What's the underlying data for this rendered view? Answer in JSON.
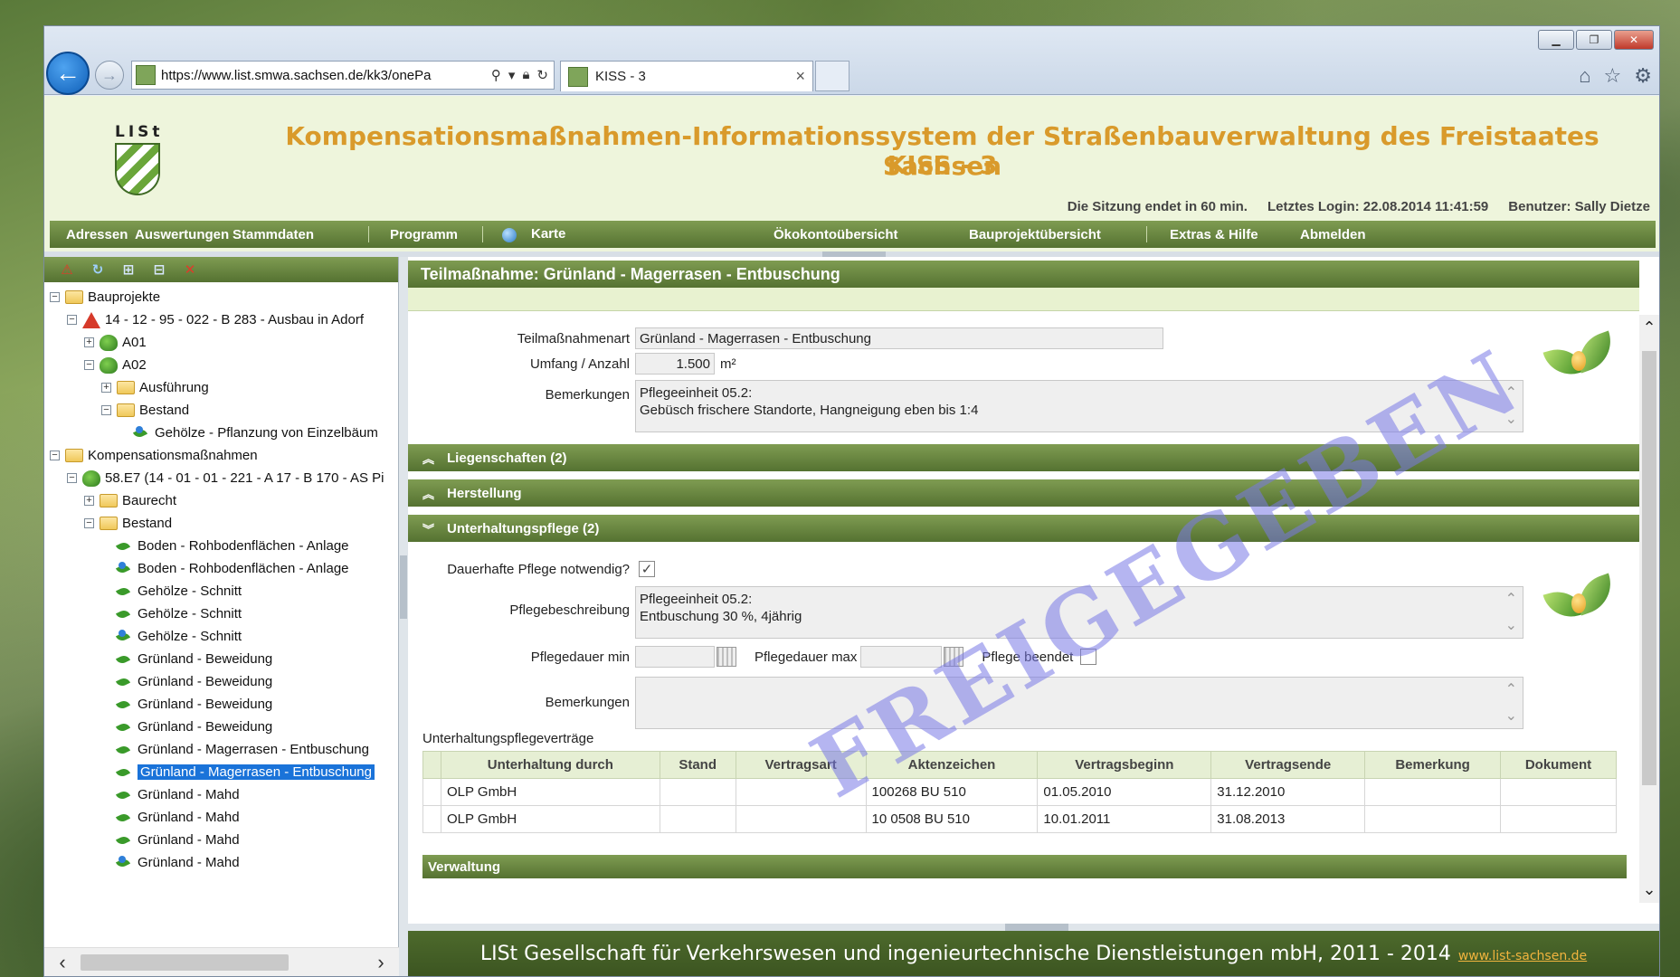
{
  "browser": {
    "url": "https://www.list.smwa.sachsen.de/kk3/onePa",
    "tab_title": "KISS - 3"
  },
  "header": {
    "logo_text": "LISt",
    "title_line1": "Kompensationsmaßnahmen-Informationssystem der Straßenbauverwaltung des Freistaates Sachsen",
    "title_line2": "KISS - 3",
    "session_end": "Die Sitzung endet in 60 min.",
    "last_login": "Letztes Login: 22.08.2014 11:41:59",
    "user": "Benutzer: Sally Dietze"
  },
  "menu": {
    "adressen": "Adressen",
    "auswertungen": "Auswertungen",
    "stammdaten": "Stammdaten",
    "programm": "Programm",
    "karte": "Karte",
    "oekokonto": "Ökokontoübersicht",
    "bauprojekt": "Bauprojektübersicht",
    "extras": "Extras & Hilfe",
    "abmelden": "Abmelden"
  },
  "tree": [
    {
      "label": "Bauprojekte",
      "level": 0,
      "toggle": "−",
      "icon": "folder"
    },
    {
      "label": "14 - 12 - 95 - 022 - B 283 - Ausbau in Adorf",
      "level": 1,
      "toggle": "−",
      "icon": "warn"
    },
    {
      "label": "A01",
      "level": 2,
      "toggle": "+",
      "icon": "tree"
    },
    {
      "label": "A02",
      "level": 2,
      "toggle": "−",
      "icon": "tree"
    },
    {
      "label": "Ausführung",
      "level": 3,
      "toggle": "+",
      "icon": "folder"
    },
    {
      "label": "Bestand",
      "level": 3,
      "toggle": "−",
      "icon": "folder"
    },
    {
      "label": "Gehölze - Pflanzung von Einzelbäum",
      "level": 4,
      "toggle": "",
      "icon": "leaf-blue"
    },
    {
      "label": "Kompensationsmaßnahmen",
      "level": 0,
      "toggle": "−",
      "icon": "folder"
    },
    {
      "label": "58.E7 (14 - 01 - 01 - 221 - A 17 - B 170 - AS Pi",
      "level": 1,
      "toggle": "−",
      "icon": "tree"
    },
    {
      "label": "Baurecht",
      "level": 2,
      "toggle": "+",
      "icon": "folder"
    },
    {
      "label": "Bestand",
      "level": 2,
      "toggle": "−",
      "icon": "folder"
    },
    {
      "label": "Boden - Rohbodenflächen - Anlage",
      "level": 3,
      "toggle": "",
      "icon": "leaf"
    },
    {
      "label": "Boden - Rohbodenflächen - Anlage",
      "level": 3,
      "toggle": "",
      "icon": "leaf-blue"
    },
    {
      "label": "Gehölze - Schnitt",
      "level": 3,
      "toggle": "",
      "icon": "leaf"
    },
    {
      "label": "Gehölze - Schnitt",
      "level": 3,
      "toggle": "",
      "icon": "leaf"
    },
    {
      "label": "Gehölze - Schnitt",
      "level": 3,
      "toggle": "",
      "icon": "leaf-blue"
    },
    {
      "label": "Grünland - Beweidung",
      "level": 3,
      "toggle": "",
      "icon": "leaf"
    },
    {
      "label": "Grünland - Beweidung",
      "level": 3,
      "toggle": "",
      "icon": "leaf"
    },
    {
      "label": "Grünland - Beweidung",
      "level": 3,
      "toggle": "",
      "icon": "leaf"
    },
    {
      "label": "Grünland - Beweidung",
      "level": 3,
      "toggle": "",
      "icon": "leaf"
    },
    {
      "label": "Grünland - Magerrasen - Entbuschung",
      "level": 3,
      "toggle": "",
      "icon": "leaf"
    },
    {
      "label": "Grünland - Magerrasen - Entbuschung",
      "level": 3,
      "toggle": "",
      "icon": "leaf",
      "selected": true
    },
    {
      "label": "Grünland - Mahd",
      "level": 3,
      "toggle": "",
      "icon": "leaf"
    },
    {
      "label": "Grünland - Mahd",
      "level": 3,
      "toggle": "",
      "icon": "leaf"
    },
    {
      "label": "Grünland - Mahd",
      "level": 3,
      "toggle": "",
      "icon": "leaf"
    },
    {
      "label": "Grünland - Mahd",
      "level": 3,
      "toggle": "",
      "icon": "leaf-blue"
    }
  ],
  "panel": {
    "title": "Teilmaßnahme: Grünland - Magerrasen - Entbuschung",
    "teilmassnahmenart_label": "Teilmaßnahmenart",
    "teilmassnahmenart_value": "Grünland - Magerrasen - Entbuschung",
    "umfang_label": "Umfang / Anzahl",
    "umfang_value": "1.500",
    "umfang_unit": "m²",
    "bemerkungen_label": "Bemerkungen",
    "bemerkungen_line1": "Pflegeeinheit 05.2:",
    "bemerkungen_line2": "Gebüsch frischere Standorte, Hangneigung eben bis 1:4"
  },
  "sections": {
    "liegenschaften": "Liegenschaften (2)",
    "herstellung": "Herstellung",
    "unterhaltungspflege": "Unterhaltungspflege (2)",
    "verwaltung": "Verwaltung"
  },
  "pflege": {
    "dauerhaft_label": "Dauerhafte Pflege notwendig?",
    "dauerhaft_checked": "✓",
    "beschreibung_label": "Pflegebeschreibung",
    "beschreibung_line1": "Pflegeeinheit 05.2:",
    "beschreibung_line2": "Entbuschung 30 %, 4jährig",
    "dauer_min_label": "Pflegedauer min",
    "dauer_max_label": "Pflegedauer max",
    "beendet_label": "Pflege beendet",
    "bemerkungen_label": "Bemerkungen",
    "vertraege_label": "Unterhaltungspflegeverträge"
  },
  "contracts": {
    "headers": [
      "Unterhaltung durch",
      "Stand",
      "Vertragsart",
      "Aktenzeichen",
      "Vertragsbeginn",
      "Vertragsende",
      "Bemerkung",
      "Dokument"
    ],
    "rows": [
      [
        "OLP GmbH",
        "",
        "",
        "100268 BU 510",
        "01.05.2010",
        "31.12.2010",
        "",
        ""
      ],
      [
        "OLP GmbH",
        "",
        "",
        "10 0508 BU 510",
        "10.01.2011",
        "31.08.2013",
        "",
        ""
      ]
    ]
  },
  "watermark": "FREIGEGEBEN",
  "footer": {
    "text": "LISt Gesellschaft für Verkehrswesen und ingenieurtechnische Dienstleistungen mbH, 2011 - 2014",
    "link": "www.list-sachsen.de"
  }
}
